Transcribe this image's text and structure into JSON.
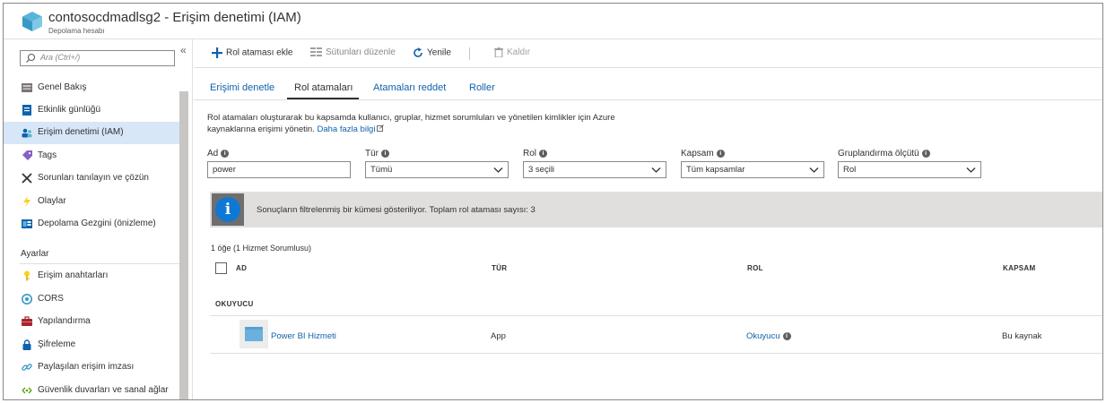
{
  "header": {
    "title": "contosocdmadlsg2 - Erişim denetimi (IAM)",
    "subtitle": "Depolama hesabı",
    "logo_icon": "storage-cube-icon"
  },
  "sidebar": {
    "search_placeholder": "Ara (Ctrl+/)",
    "collapse_glyph": "«",
    "items": [
      {
        "label": "Genel Bakış",
        "icon": "overview-icon"
      },
      {
        "label": "Etkinlik günlüğü",
        "icon": "activity-log-icon"
      },
      {
        "label": "Erişim denetimi (IAM)",
        "icon": "iam-icon",
        "active": true
      },
      {
        "label": "Tags",
        "icon": "tag-icon"
      },
      {
        "label": "Sorunları tanılayın ve çözün",
        "icon": "wrench-icon"
      },
      {
        "label": "Olaylar",
        "icon": "lightning-icon"
      },
      {
        "label": "Depolama Gezgini (önizleme)",
        "icon": "storage-explorer-icon"
      }
    ],
    "section_label": "Ayarlar",
    "settings_items": [
      {
        "label": "Erişim anahtarları",
        "icon": "key-icon"
      },
      {
        "label": "CORS",
        "icon": "cors-icon"
      },
      {
        "label": "Yapılandırma",
        "icon": "configuration-icon"
      },
      {
        "label": "Şifreleme",
        "icon": "lock-icon"
      },
      {
        "label": "Paylaşılan erişim imzası",
        "icon": "link-icon"
      },
      {
        "label": "Güvenlik duvarları ve sanal ağlar",
        "icon": "firewall-icon"
      }
    ]
  },
  "toolbar": {
    "add_label": "Rol ataması ekle",
    "columns_label": "Sütunları düzenle",
    "refresh_label": "Yenile",
    "remove_label": "Kaldır"
  },
  "tabs": [
    {
      "label": "Erişimi denetle"
    },
    {
      "label": "Rol atamaları",
      "active": true
    },
    {
      "label": "Atamaları reddet"
    },
    {
      "label": "Roller"
    }
  ],
  "description": {
    "line1": "Rol atamaları oluşturarak bu kapsamda kullanıcı, gruplar, hizmet sorumluları ve yönetilen kimlikler için Azure",
    "line2": "kaynaklarına erişimi yönetin.",
    "link": "Daha fazla bilgi"
  },
  "filters": {
    "name": {
      "label": "Ad",
      "value": "power"
    },
    "type": {
      "label": "Tür",
      "value": "Tümü"
    },
    "role": {
      "label": "Rol",
      "value": "3 seçili"
    },
    "scope": {
      "label": "Kapsam",
      "value": "Tüm kapsamlar"
    },
    "group_by": {
      "label": "Gruplandırma ölçütü",
      "value": "Rol"
    }
  },
  "banner": {
    "text": "Sonuçların filtrelenmiş bir kümesi gösteriliyor. Toplam rol ataması sayısı: 3",
    "icon": "info-icon"
  },
  "results": {
    "count": "1 öğe (1 Hizmet Sorumlusu)",
    "columns": [
      "AD",
      "TÜR",
      "ROL",
      "KAPSAM"
    ],
    "group": "OKUYUCU",
    "rows": [
      {
        "name": "Power BI Hizmeti",
        "type": "App",
        "role": "Okuyucu",
        "scope": "Bu kaynak"
      }
    ]
  },
  "colors": {
    "accent": "#0f62ad",
    "active_nav": "#d7e7f8",
    "banner_bg": "#e1dfdd",
    "info_blue": "#0f78d4"
  }
}
